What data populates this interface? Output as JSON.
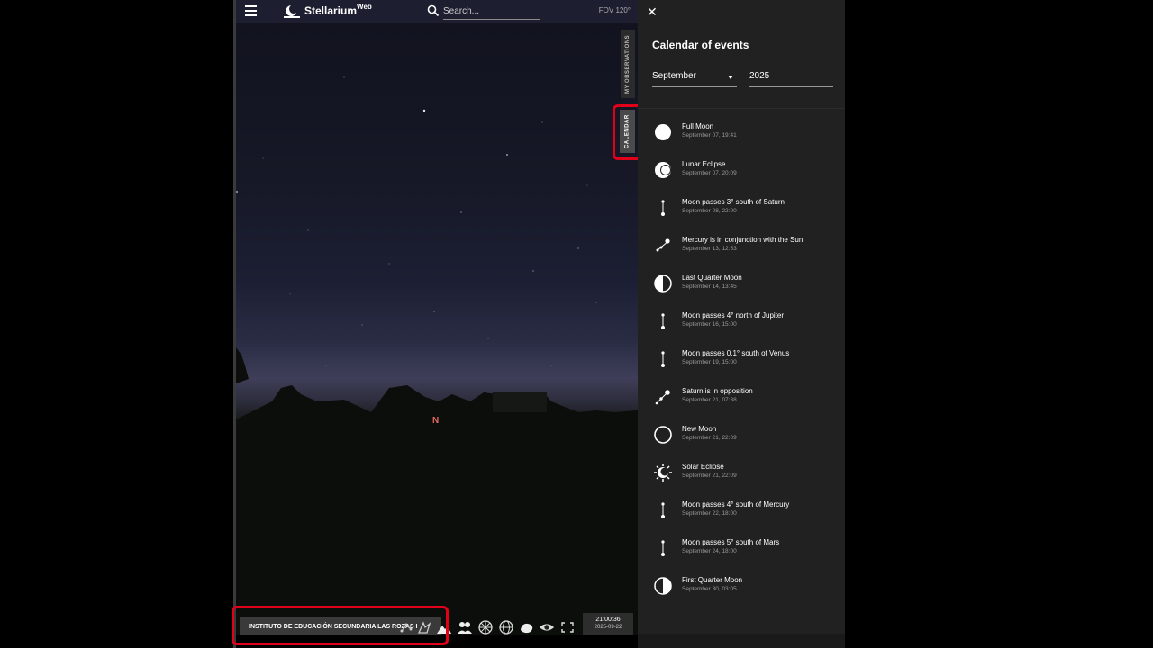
{
  "header": {
    "brand": "Stellarium",
    "brand_sup": "Web",
    "search_placeholder": "Search...",
    "fov": "FOV 120°"
  },
  "side_tabs": {
    "observations": "MY OBSERVATIONS",
    "calendar": "CALENDAR"
  },
  "sky": {
    "compass_north": "N"
  },
  "bottom_bar": {
    "location": "INSTITUTO DE EDUCACIÓN SECUNDARIA LAS ROZAS I",
    "time": "21:00:36",
    "date": "2025-09-22"
  },
  "panel": {
    "close_icon": "close-icon",
    "title": "Calendar of events",
    "month": "September",
    "year": "2025",
    "events": [
      {
        "name": "Full Moon",
        "date": "September 07, 19:41",
        "icon": "full-moon-icon"
      },
      {
        "name": "Lunar Eclipse",
        "date": "September 07, 20:09",
        "icon": "lunar-eclipse-icon"
      },
      {
        "name": "Moon passes 3° south of Saturn",
        "date": "September 08, 22:00",
        "icon": "conjunction-icon"
      },
      {
        "name": "Mercury is in conjunction with the Sun",
        "date": "September 13, 12:53",
        "icon": "sun-conjunction-icon"
      },
      {
        "name": "Last Quarter Moon",
        "date": "September 14, 13:45",
        "icon": "last-quarter-icon"
      },
      {
        "name": "Moon passes 4° north of Jupiter",
        "date": "September 16, 15:00",
        "icon": "conjunction-icon"
      },
      {
        "name": "Moon passes 0.1° south of Venus",
        "date": "September 19, 15:00",
        "icon": "conjunction-icon"
      },
      {
        "name": "Saturn is in opposition",
        "date": "September 21, 07:38",
        "icon": "opposition-icon"
      },
      {
        "name": "New Moon",
        "date": "September 21, 22:09",
        "icon": "new-moon-icon"
      },
      {
        "name": "Solar Eclipse",
        "date": "September 21, 22:09",
        "icon": "solar-eclipse-icon"
      },
      {
        "name": "Moon passes 4° south of Mercury",
        "date": "September 22, 18:00",
        "icon": "conjunction-icon"
      },
      {
        "name": "Moon passes 5° south of Mars",
        "date": "September 24, 18:00",
        "icon": "conjunction-icon"
      },
      {
        "name": "First Quarter Moon",
        "date": "September 30, 03:05",
        "icon": "first-quarter-icon"
      }
    ]
  },
  "colors": {
    "highlight": "#e0001a",
    "panel_bg": "#212121",
    "topbar_bg": "#1d1f31"
  }
}
